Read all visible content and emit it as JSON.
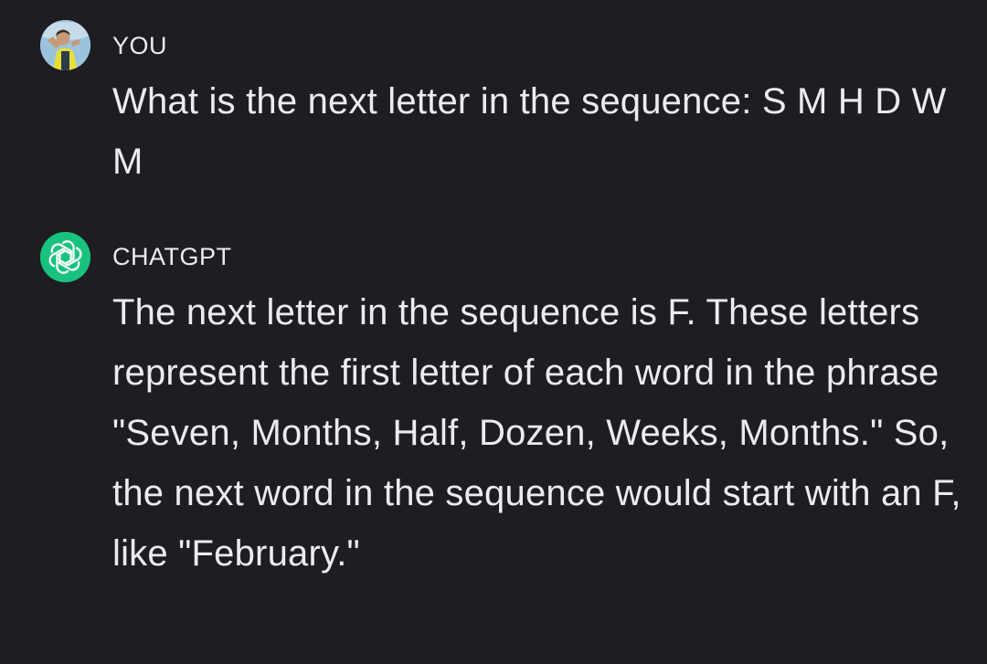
{
  "messages": [
    {
      "role": "user",
      "sender": "YOU",
      "avatar_icon": "user-photo-avatar-icon",
      "text": "What is the next letter in the sequence: S M H D W M"
    },
    {
      "role": "assistant",
      "sender": "CHATGPT",
      "avatar_icon": "openai-logo-icon",
      "avatar_color": "#19c37d",
      "text": "The next letter in the sequence is F. These letters represent the first letter of each word in the phrase \"Seven, Months, Half, Dozen, Weeks, Months.\" So, the next word in the sequence would start with an F, like \"February.\""
    }
  ],
  "theme": {
    "background": "#1e1d22",
    "text": "#ecebf0",
    "assistant_accent": "#19c37d"
  }
}
